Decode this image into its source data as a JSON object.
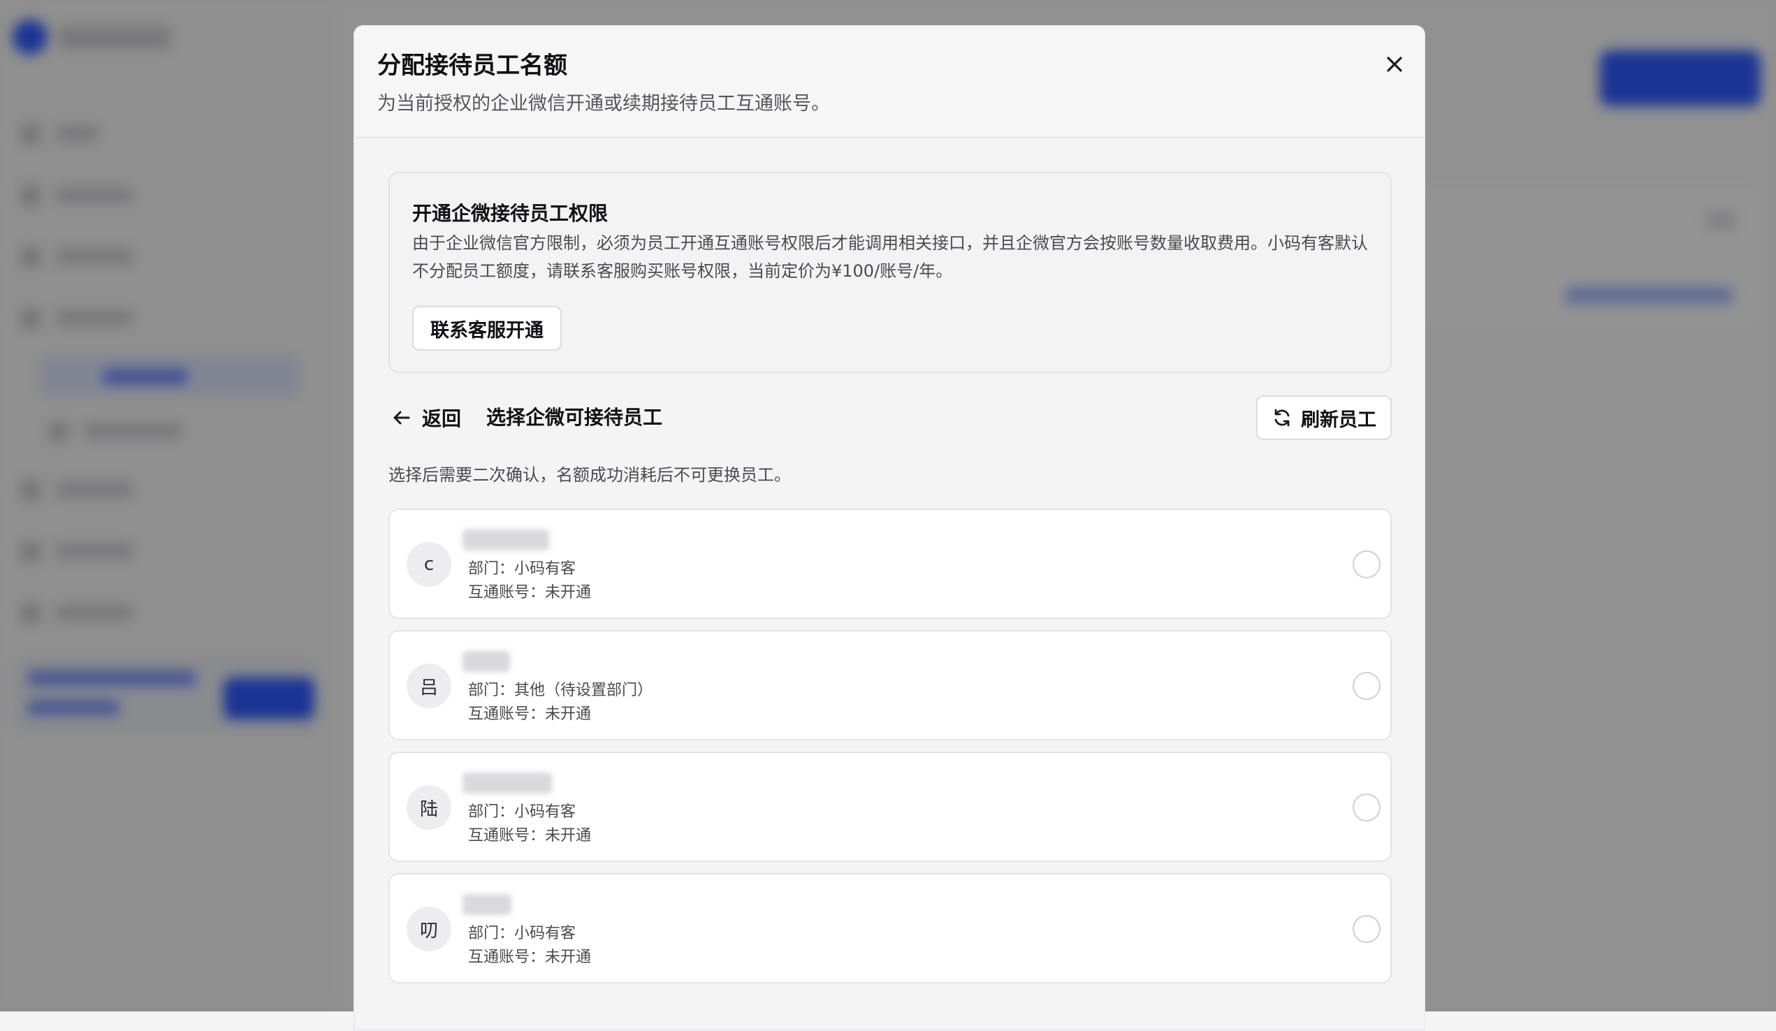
{
  "modal": {
    "title": "分配接待员工名额",
    "subtitle": "为当前授权的企业微信开通或续期接待员工互通账号。"
  },
  "notice": {
    "title": "开通企微接待员工权限",
    "text": "由于企业微信官方限制，必须为员工开通互通账号权限后才能调用相关接口，并且企微官方会按账号数量收取费用。小码有客默认不分配员工额度，请联系客服购买账号权限，当前定价为¥100/账号/年。",
    "contact_button": "联系客服开通"
  },
  "section": {
    "back_label": "返回",
    "title": "选择企微可接待员工",
    "refresh_button": "刷新员工"
  },
  "hint": "选择后需要二次确认，名额成功消耗后不可更换员工。",
  "employees": [
    {
      "avatar": "c",
      "department": "部门：小码有客",
      "account": "互通账号：未开通"
    },
    {
      "avatar": "吕",
      "department": "部门：其他（待设置部门）",
      "account": "互通账号：未开通"
    },
    {
      "avatar": "陆",
      "department": "部门：小码有客",
      "account": "互通账号：未开通"
    },
    {
      "avatar": "叨",
      "department": "部门：小码有客",
      "account": "互通账号：未开通"
    }
  ],
  "colors": {
    "overlay": "#6b6b6b",
    "accent": "#2e5bff",
    "text_primary": "#111114",
    "text_secondary": "#4a4a52"
  },
  "icons": {
    "close": "close-icon",
    "back": "arrow-left-icon",
    "refresh": "refresh-icon"
  }
}
